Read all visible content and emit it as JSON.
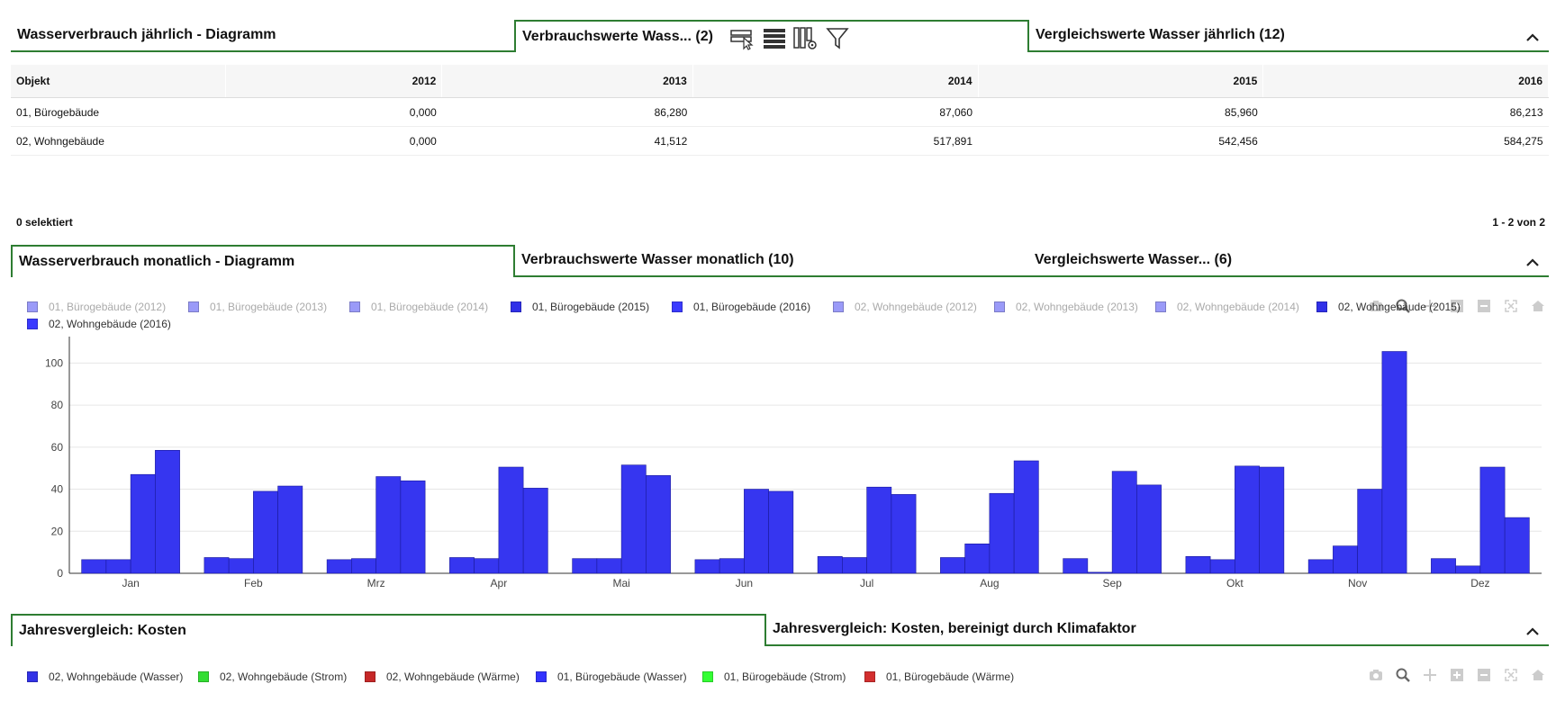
{
  "panel1": {
    "tabs": [
      {
        "label": "Wasserverbrauch jährlich - Diagramm",
        "active": false
      },
      {
        "label": "Verbrauchswerte Wass...  (2)",
        "active": true
      },
      {
        "label": "Vergleichswerte Wasser jährlich (12)",
        "active": false
      }
    ],
    "table": {
      "headers": [
        "Objekt",
        "2012",
        "2013",
        "2014",
        "2015",
        "2016"
      ],
      "rows": [
        [
          "01, Bürogebäude",
          "0,000",
          "86,280",
          "87,060",
          "85,960",
          "86,213"
        ],
        [
          "02, Wohngebäude",
          "0,000",
          "41,512",
          "517,891",
          "542,456",
          "584,275"
        ]
      ]
    },
    "selected_text": "0 selektiert",
    "pagination_text": "1 - 2 von 2"
  },
  "panel2": {
    "tabs": [
      {
        "label": "Wasserverbrauch monatlich - Diagramm",
        "active": true
      },
      {
        "label": "Verbrauchswerte Wasser monatlich (10)",
        "active": false
      },
      {
        "label": "Vergleichswerte Wasser...  (6)",
        "active": false
      }
    ],
    "legend": [
      {
        "label": "01, Bürogebäude (2012)",
        "color": "#9a9af8",
        "faded": true
      },
      {
        "label": "01, Bürogebäude (2013)",
        "color": "#9a9af8",
        "faded": true
      },
      {
        "label": "01, Bürogebäude (2014)",
        "color": "#9a9af8",
        "faded": true
      },
      {
        "label": "01, Bürogebäude (2015)",
        "color": "#3030e8",
        "faded": false
      },
      {
        "label": "01, Bürogebäude (2016)",
        "color": "#3a3aff",
        "faded": false
      },
      {
        "label": "02, Wohngebäude (2012)",
        "color": "#9a9af8",
        "faded": true
      },
      {
        "label": "02, Wohngebäude (2013)",
        "color": "#9a9af8",
        "faded": true
      },
      {
        "label": "02, Wohngebäude (2014)",
        "color": "#9a9af8",
        "faded": true
      },
      {
        "label": "02, Wohngebäude (2015)",
        "color": "#3030e8",
        "faded": false
      },
      {
        "label": "02, Wohngebäude (2016)",
        "color": "#3a3aff",
        "faded": false
      }
    ]
  },
  "chart_data": {
    "type": "bar",
    "categories": [
      "Jan",
      "Feb",
      "Mrz",
      "Apr",
      "Mai",
      "Jun",
      "Jul",
      "Aug",
      "Sep",
      "Okt",
      "Nov",
      "Dez"
    ],
    "series": [
      {
        "name": "01, Bürogebäude (2015)",
        "values": [
          6.5,
          7.5,
          6.5,
          7.5,
          7,
          6.5,
          8,
          7.5,
          7,
          8,
          6.5,
          7
        ]
      },
      {
        "name": "01, Bürogebäude (2016)",
        "values": [
          6.5,
          7,
          7,
          7,
          7,
          7,
          7.5,
          14,
          0.5,
          6.5,
          13,
          3.5
        ]
      },
      {
        "name": "02, Wohngebäude (2015)",
        "values": [
          47,
          39,
          46,
          50.5,
          51.5,
          40,
          41,
          38,
          48.5,
          51,
          40,
          50.5
        ]
      },
      {
        "name": "02, Wohngebäude (2016)",
        "values": [
          58.5,
          41.5,
          44,
          40.5,
          46.5,
          39,
          37.5,
          53.5,
          42,
          50.5,
          105.5,
          26.5
        ]
      }
    ],
    "colors": [
      "#3232f0",
      "#3232f0",
      "#3232f0",
      "#3232f0"
    ],
    "yticks": [
      0,
      20,
      40,
      60,
      80,
      100
    ],
    "ylim": [
      0,
      110
    ],
    "grid": true
  },
  "panel3": {
    "tabs": [
      {
        "label": "Jahresvergleich: Kosten",
        "active": true
      },
      {
        "label": "Jahresvergleich: Kosten, bereinigt durch Klimafaktor",
        "active": false
      }
    ],
    "legend": [
      {
        "label": "02, Wohngebäude (Wasser)",
        "color": "#3232e6"
      },
      {
        "label": "02, Wohngebäude (Strom)",
        "color": "#33dd33"
      },
      {
        "label": "02, Wohngebäude (Wärme)",
        "color": "#c62828"
      },
      {
        "label": "01, Bürogebäude (Wasser)",
        "color": "#3232ff"
      },
      {
        "label": "01, Bürogebäude (Strom)",
        "color": "#33ff33"
      },
      {
        "label": "01, Bürogebäude (Wärme)",
        "color": "#d32f2f"
      }
    ]
  },
  "icons": {
    "toolbar": [
      "select-rows-icon",
      "list-icon",
      "column-settings-icon",
      "filter-icon"
    ],
    "modebar": [
      "camera-icon",
      "zoom-icon",
      "pan-icon",
      "zoom-in-icon",
      "zoom-out-icon",
      "autoscale-icon",
      "home-icon"
    ],
    "collapse": "chevron-up-icon"
  }
}
